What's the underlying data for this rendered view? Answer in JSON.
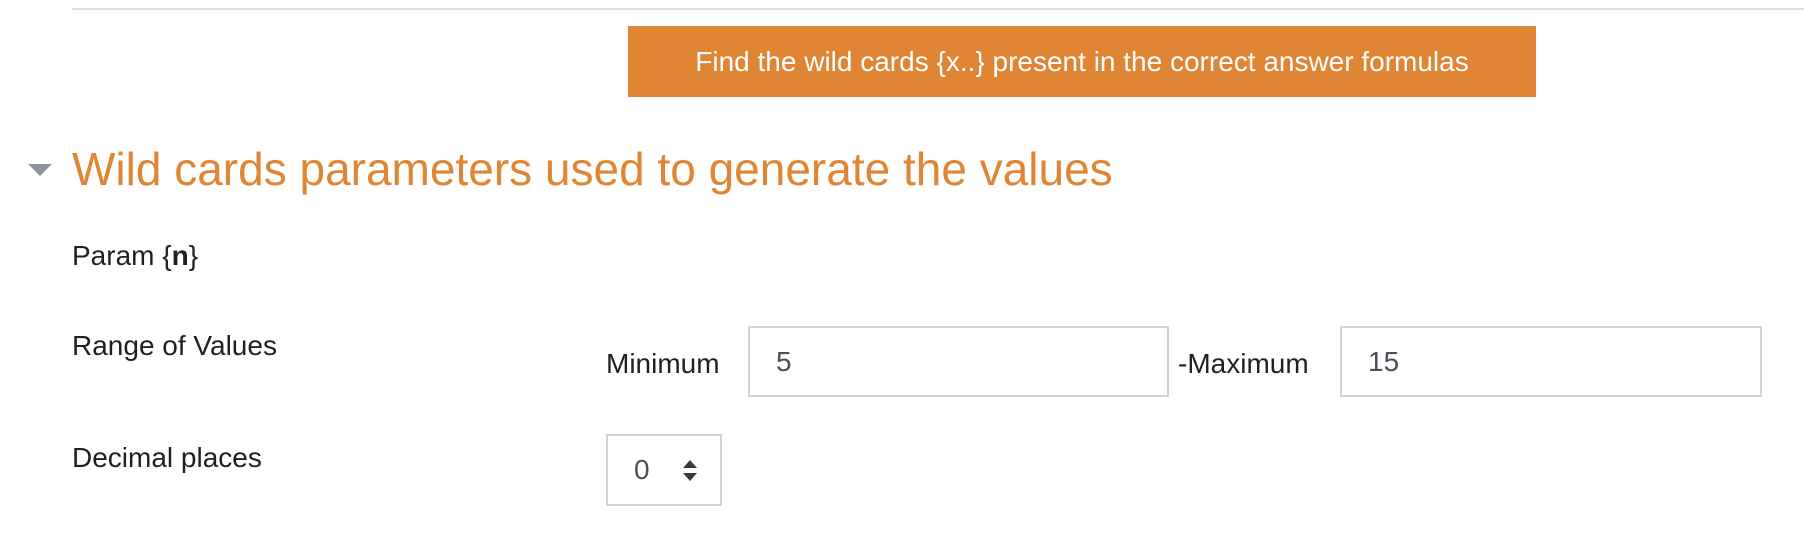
{
  "toolbar": {
    "find_wildcards_label": "Find the wild cards {x..} present in the correct answer formulas"
  },
  "section": {
    "title": "Wild cards parameters used to generate the values",
    "toggle_icon": "caret-down-icon"
  },
  "param": {
    "prefix": "Param {",
    "name": "n",
    "suffix": "}"
  },
  "range": {
    "label": "Range of Values",
    "min_label": "Minimum",
    "min_value": "5",
    "max_label": "-Maximum",
    "max_value": "15"
  },
  "decimal": {
    "label": "Decimal places",
    "selected": "0",
    "arrows_icon": "sort-arrows-icon"
  },
  "colors": {
    "accent": "#e08534",
    "text": "#1d2125",
    "input_border": "#ced4da"
  }
}
